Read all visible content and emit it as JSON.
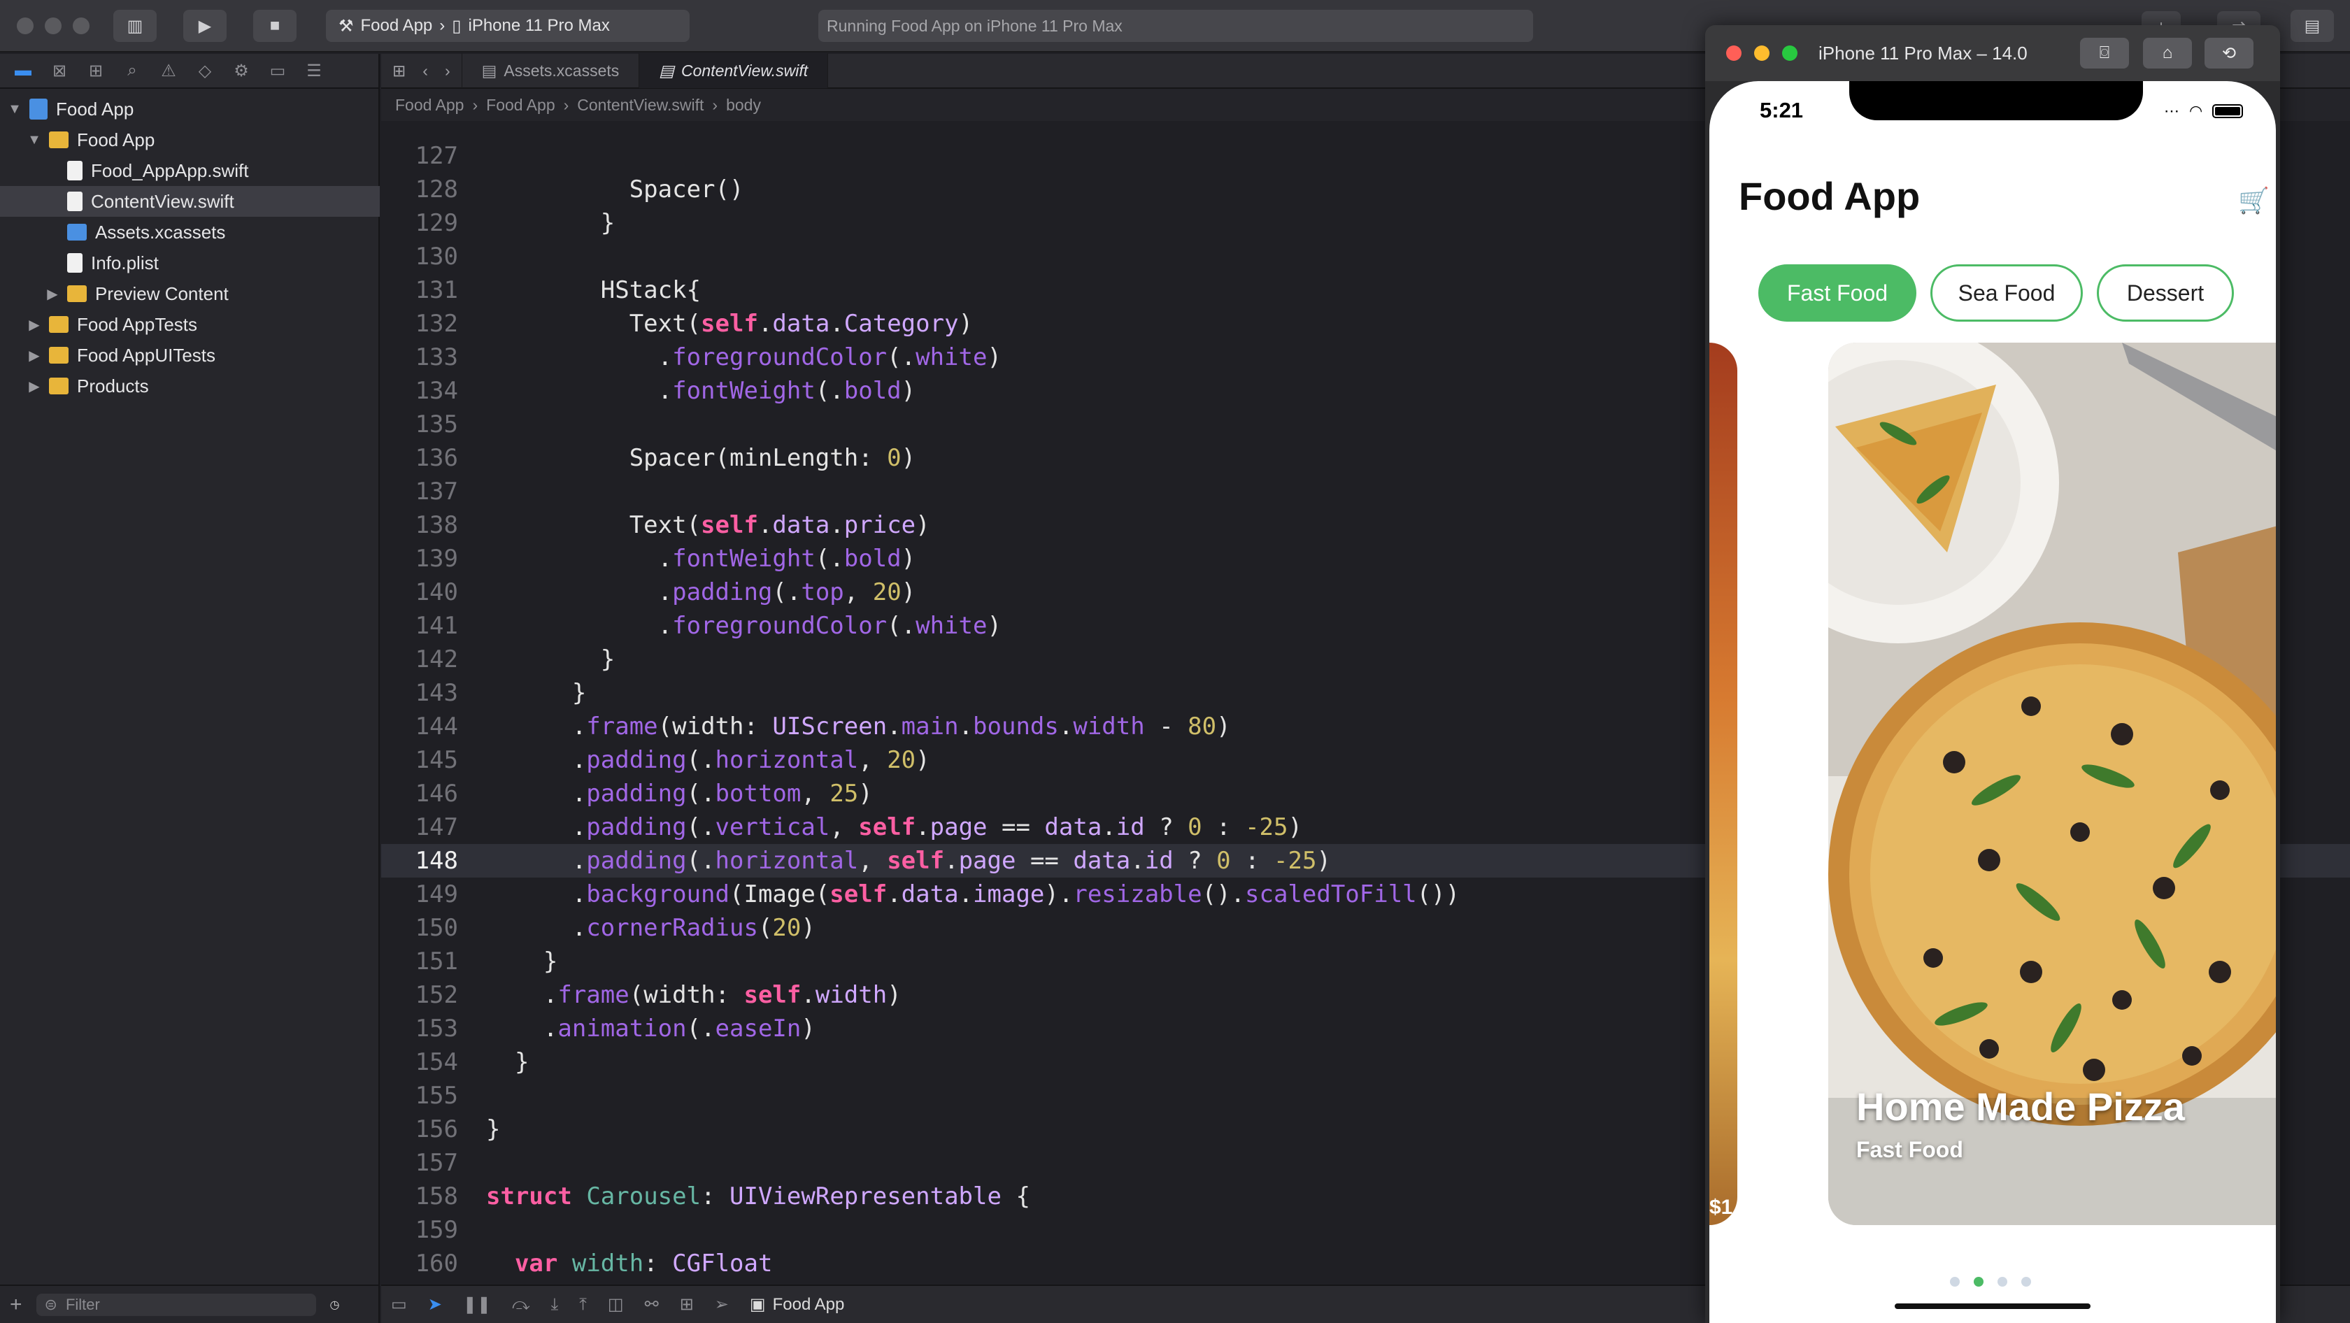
{
  "toolbar": {
    "scheme_app": "Food App",
    "scheme_device": "iPhone 11 Pro Max",
    "status": "Running Food App on iPhone 11 Pro Max"
  },
  "navigator": {
    "items": [
      {
        "label": "Food App",
        "level": 0,
        "type": "project"
      },
      {
        "label": "Food App",
        "level": 1,
        "type": "folder"
      },
      {
        "label": "Food_AppApp.swift",
        "level": 2,
        "type": "swift"
      },
      {
        "label": "ContentView.swift",
        "level": 2,
        "type": "swift"
      },
      {
        "label": "Assets.xcassets",
        "level": 2,
        "type": "assets"
      },
      {
        "label": "Info.plist",
        "level": 2,
        "type": "plist"
      },
      {
        "label": "Preview Content",
        "level": 2,
        "type": "folder"
      },
      {
        "label": "Food AppTests",
        "level": 1,
        "type": "folder"
      },
      {
        "label": "Food AppUITests",
        "level": 1,
        "type": "folder"
      },
      {
        "label": "Products",
        "level": 1,
        "type": "folder"
      }
    ],
    "filter_placeholder": "Filter"
  },
  "editor": {
    "tabs": [
      "Assets.xcassets",
      "ContentView.swift"
    ],
    "breadcrumb": [
      "Food App",
      "Food App",
      "ContentView.swift",
      "body"
    ],
    "current_line": "148"
  },
  "debug": {
    "target": "Food App"
  },
  "simulator": {
    "title": "iPhone 11 Pro Max – 14.0",
    "time": "5:21",
    "app_title": "Food App",
    "categories": [
      "Fast Food",
      "Sea Food",
      "Dessert"
    ],
    "selected_category": "Fast Food",
    "card_title": "Home Made Pizza",
    "card_category": "Fast Food",
    "left_card_price": "$1",
    "page_dots": 4,
    "active_dot": 2
  },
  "colors": {
    "accent_green": "#4cbb65",
    "keyword": "#fc5fa3",
    "type": "#d0a8ff",
    "number": "#d0bf69"
  }
}
